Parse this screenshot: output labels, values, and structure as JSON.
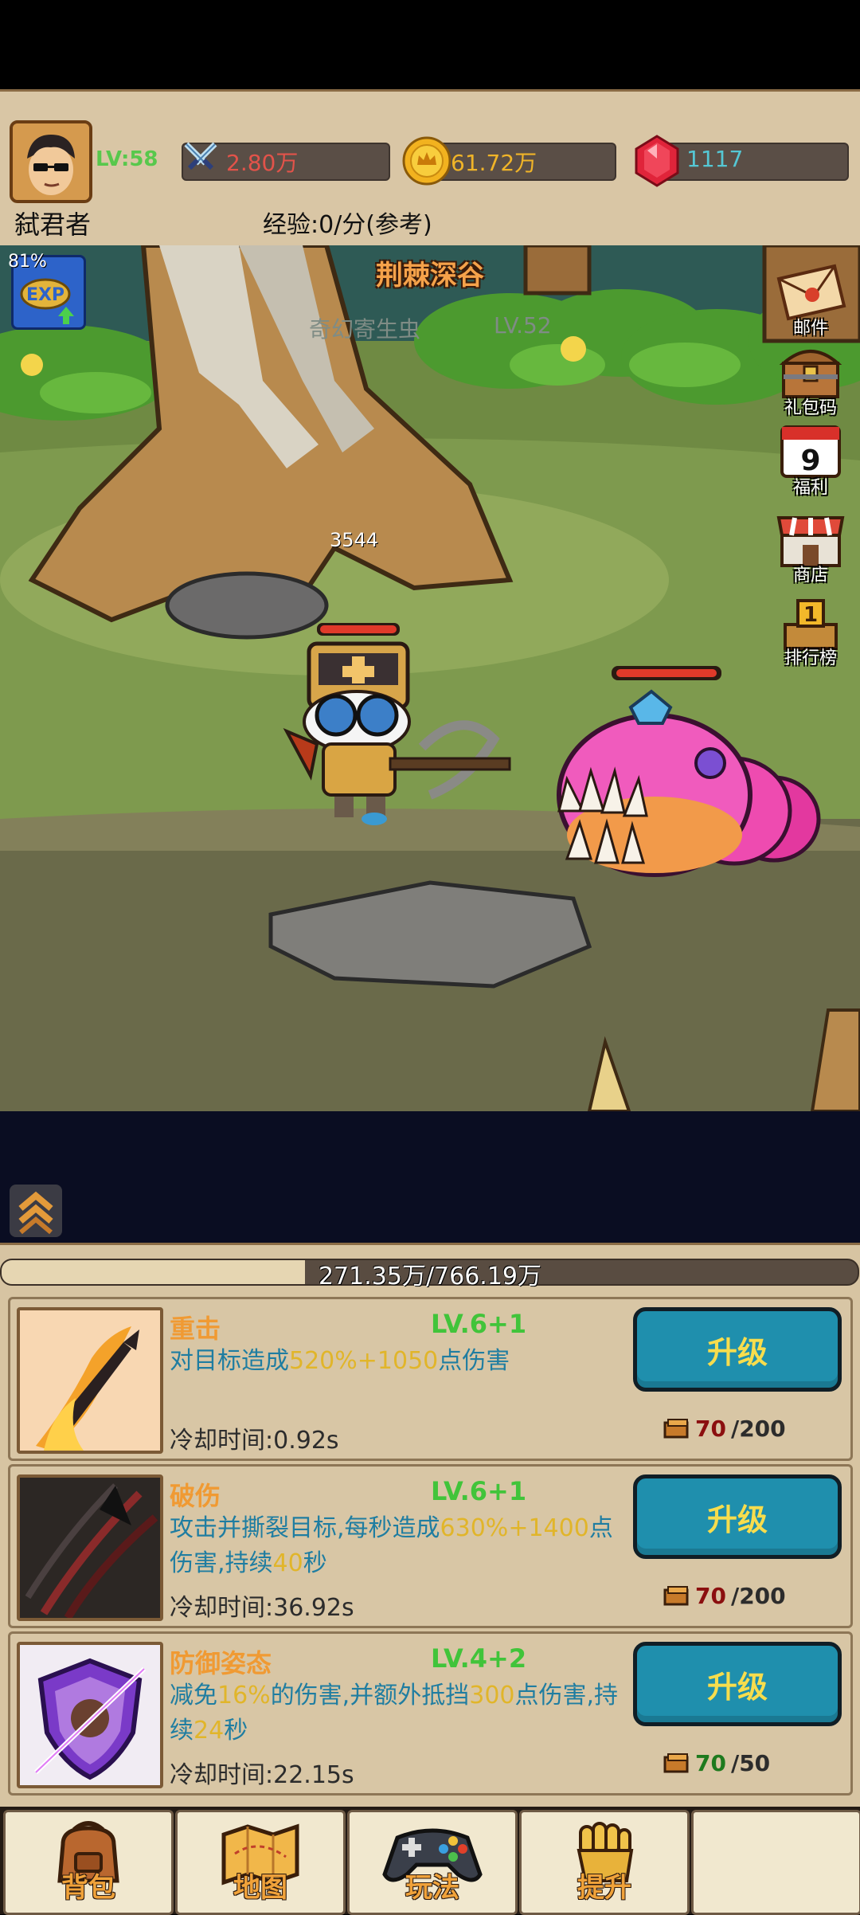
{
  "player": {
    "level": "LV:58",
    "name": "弑君者",
    "power": "2.80万",
    "gold": "61.72万",
    "gems": "1117",
    "exp_rate": "经验:0/分(参考)",
    "exp_boost_percent": "81%"
  },
  "stage": {
    "location": "荆棘深谷",
    "enemy_name": "奇幻寄生虫",
    "enemy_level": "LV.52",
    "damage_number": "3544"
  },
  "side_menu": [
    {
      "label": "邮件",
      "icon": "mail-icon"
    },
    {
      "label": "礼包码",
      "icon": "treasure-chest-icon"
    },
    {
      "label": "福利",
      "icon": "calendar-icon",
      "badge": "9"
    },
    {
      "label": "商店",
      "icon": "shop-icon"
    },
    {
      "label": "排行榜",
      "icon": "trophy-icon",
      "badge": "1"
    }
  ],
  "exp_bar": {
    "text": "271.35万/766.19万",
    "fill_fraction": 0.354
  },
  "skills": [
    {
      "name": "重击",
      "level": "LV.6+1",
      "desc_parts": [
        "对目标造成",
        "520%+1050",
        "点伤害"
      ],
      "cooldown": "冷却时间:0.92s",
      "button": "升级",
      "cost_have": "70",
      "cost_need": "/200",
      "icon": "flame-blade-icon"
    },
    {
      "name": "破伤",
      "level": "LV.6+1",
      "desc_parts": [
        "攻击并撕裂目标,每秒造成",
        "630%+1400",
        "点伤害,持续",
        "40",
        "秒"
      ],
      "cooldown": "冷却时间:36.92s",
      "button": "升级",
      "cost_have": "70",
      "cost_need": "/200",
      "icon": "claw-slash-icon"
    },
    {
      "name": "防御姿态",
      "level": "LV.4+2",
      "desc_parts": [
        "减免",
        "16%",
        "的伤害,并额外抵挡",
        "300",
        "点伤害,持续",
        "24",
        "秒"
      ],
      "cooldown": "冷却时间:22.15s",
      "button": "升级",
      "cost_have": "70",
      "cost_need": "/50",
      "icon": "shield-icon"
    }
  ],
  "bottom_nav": [
    {
      "label": "背包",
      "icon": "backpack-icon"
    },
    {
      "label": "地图",
      "icon": "map-icon"
    },
    {
      "label": "玩法",
      "icon": "gamepad-icon"
    },
    {
      "label": "提升",
      "icon": "fist-icon"
    },
    {
      "label": "",
      "icon": ""
    }
  ],
  "colors": {
    "accent_blue": "#1f8fad",
    "accent_gold": "#f7dd4d",
    "panel_bg": "#d7c4a2",
    "skill_name": "#f09a33",
    "skill_level": "#41c43a"
  }
}
